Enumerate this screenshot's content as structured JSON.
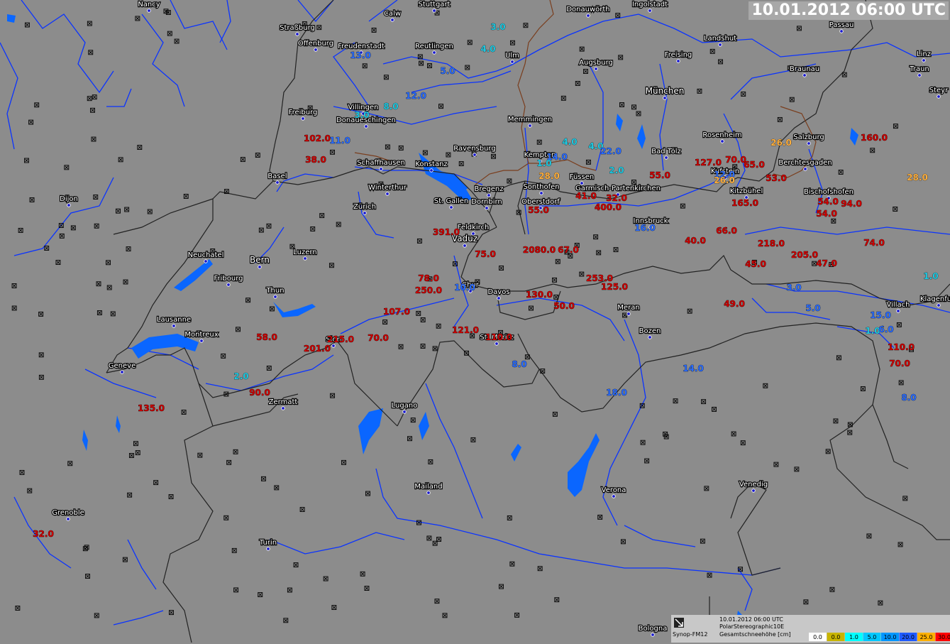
{
  "header": {
    "timestamp": "10.01.2012 06:00 UTC"
  },
  "colors": {
    "background": "#8c8c8c",
    "water": "#0a66ff",
    "border": "#222222",
    "red_value": "#cc0000",
    "cyan_value": "#20c8e0",
    "blue_value": "#2a6cff",
    "orange_value": "#ffb040"
  },
  "cities": [
    {
      "name": "Nancy"
    },
    {
      "name": "Stuttgart"
    },
    {
      "name": "Calw"
    },
    {
      "name": "Donauwörth"
    },
    {
      "name": "Ingolstadt"
    },
    {
      "name": "Straßburg"
    },
    {
      "name": "Offenburg"
    },
    {
      "name": "Freudenstadt"
    },
    {
      "name": "Reutlingen"
    },
    {
      "name": "Ulm"
    },
    {
      "name": "Augsburg"
    },
    {
      "name": "Freising"
    },
    {
      "name": "Landshut"
    },
    {
      "name": "Passau"
    },
    {
      "name": "Linz"
    },
    {
      "name": "Traun"
    },
    {
      "name": "Steyr"
    },
    {
      "name": "Braunau"
    },
    {
      "name": "München"
    },
    {
      "name": "Freiburg"
    },
    {
      "name": "Villingen"
    },
    {
      "name": "Donaueschingen"
    },
    {
      "name": "Memmingen"
    },
    {
      "name": "Ravensburg"
    },
    {
      "name": "Kempten"
    },
    {
      "name": "Bad Tölz"
    },
    {
      "name": "Rosenheim"
    },
    {
      "name": "Salzburg"
    },
    {
      "name": "Schaffhausen"
    },
    {
      "name": "Konstanz"
    },
    {
      "name": "Berchtesgaden"
    },
    {
      "name": "Basel"
    },
    {
      "name": "Kufstein"
    },
    {
      "name": "Füssen"
    },
    {
      "name": "Sonthofen"
    },
    {
      "name": "Garmisch-Partenkirchen"
    },
    {
      "name": "Bregenz"
    },
    {
      "name": "Winterthur"
    },
    {
      "name": "Kitzbühel"
    },
    {
      "name": "Bischofshofen"
    },
    {
      "name": "Dijon"
    },
    {
      "name": "Zürich"
    },
    {
      "name": "St. Gallen"
    },
    {
      "name": "Dornbirn"
    },
    {
      "name": "Oberstdorf"
    },
    {
      "name": "Innsbruck"
    },
    {
      "name": "Feldkirch"
    },
    {
      "name": "Vaduz"
    },
    {
      "name": "Neuchatel"
    },
    {
      "name": "Luzern"
    },
    {
      "name": "Bern"
    },
    {
      "name": "Fribourg"
    },
    {
      "name": "Thun"
    },
    {
      "name": "Chur"
    },
    {
      "name": "Davos"
    },
    {
      "name": "Meran"
    },
    {
      "name": "Villach"
    },
    {
      "name": "Klagenfurt"
    },
    {
      "name": "Lausanne"
    },
    {
      "name": "Montreux"
    },
    {
      "name": "Sion"
    },
    {
      "name": "St. Moritz"
    },
    {
      "name": "Bozen"
    },
    {
      "name": "Geneve"
    },
    {
      "name": "Zermatt"
    },
    {
      "name": "Lugano"
    },
    {
      "name": "Mailand"
    },
    {
      "name": "Verona"
    },
    {
      "name": "Venedig"
    },
    {
      "name": "Grenoble"
    },
    {
      "name": "Turin"
    },
    {
      "name": "Bologna"
    }
  ],
  "values": [
    {
      "text": "3.0",
      "cat": "c"
    },
    {
      "text": "4.0",
      "cat": "c"
    },
    {
      "text": "13.0",
      "cat": "b"
    },
    {
      "text": "5.0",
      "cat": "b"
    },
    {
      "text": "12.0",
      "cat": "b"
    },
    {
      "text": "8.0",
      "cat": "c"
    },
    {
      "text": "3.0",
      "cat": "c"
    },
    {
      "text": "11.0",
      "cat": "b"
    },
    {
      "text": "102.0",
      "cat": "r"
    },
    {
      "text": "38.0",
      "cat": "r"
    },
    {
      "text": "4.0",
      "cat": "c"
    },
    {
      "text": "4.0",
      "cat": "c"
    },
    {
      "text": "22.0",
      "cat": "b"
    },
    {
      "text": "14.0",
      "cat": "b"
    },
    {
      "text": "2.0",
      "cat": "c"
    },
    {
      "text": "28.0",
      "cat": "o"
    },
    {
      "text": "1.0",
      "cat": "c"
    },
    {
      "text": "55.0",
      "cat": "r"
    },
    {
      "text": "127.0",
      "cat": "r"
    },
    {
      "text": "70.0",
      "cat": "r"
    },
    {
      "text": "65.0",
      "cat": "r"
    },
    {
      "text": "12.0",
      "cat": "b"
    },
    {
      "text": "26.0",
      "cat": "o"
    },
    {
      "text": "53.0",
      "cat": "r"
    },
    {
      "text": "26.0",
      "cat": "o"
    },
    {
      "text": "160.0",
      "cat": "r"
    },
    {
      "text": "28.0",
      "cat": "o"
    },
    {
      "text": "41.0",
      "cat": "r"
    },
    {
      "text": "32.0",
      "cat": "r"
    },
    {
      "text": "400.0",
      "cat": "r"
    },
    {
      "text": "55.0",
      "cat": "r"
    },
    {
      "text": "165.0",
      "cat": "r"
    },
    {
      "text": "54.0",
      "cat": "r"
    },
    {
      "text": "94.0",
      "cat": "r"
    },
    {
      "text": "54.0",
      "cat": "r"
    },
    {
      "text": "16.0",
      "cat": "b"
    },
    {
      "text": "391.0",
      "cat": "r"
    },
    {
      "text": "75.0",
      "cat": "r"
    },
    {
      "text": "2080.0",
      "cat": "r"
    },
    {
      "text": "67.0",
      "cat": "r"
    },
    {
      "text": "40.0",
      "cat": "r"
    },
    {
      "text": "66.0",
      "cat": "r"
    },
    {
      "text": "218.0",
      "cat": "r"
    },
    {
      "text": "74.0",
      "cat": "r"
    },
    {
      "text": "45.0",
      "cat": "r"
    },
    {
      "text": "205.0",
      "cat": "r"
    },
    {
      "text": "47.0",
      "cat": "r"
    },
    {
      "text": "1.0",
      "cat": "c"
    },
    {
      "text": "78.0",
      "cat": "r"
    },
    {
      "text": "250.0",
      "cat": "r"
    },
    {
      "text": "10.0",
      "cat": "b"
    },
    {
      "text": "253.0",
      "cat": "r"
    },
    {
      "text": "125.0",
      "cat": "r"
    },
    {
      "text": "130.0",
      "cat": "r"
    },
    {
      "text": "3.0",
      "cat": "b"
    },
    {
      "text": "5.0",
      "cat": "b"
    },
    {
      "text": "49.0",
      "cat": "r"
    },
    {
      "text": "15.0",
      "cat": "b"
    },
    {
      "text": "107.0",
      "cat": "r"
    },
    {
      "text": "50.0",
      "cat": "r"
    },
    {
      "text": "1.0",
      "cat": "c"
    },
    {
      "text": "6.0",
      "cat": "b"
    },
    {
      "text": "121.0",
      "cat": "r"
    },
    {
      "text": "110.0",
      "cat": "r"
    },
    {
      "text": "58.0",
      "cat": "r"
    },
    {
      "text": "215.0",
      "cat": "r"
    },
    {
      "text": "70.0",
      "cat": "r"
    },
    {
      "text": "201.0",
      "cat": "r"
    },
    {
      "text": "110.0",
      "cat": "r"
    },
    {
      "text": "70.0",
      "cat": "r"
    },
    {
      "text": "8.0",
      "cat": "b"
    },
    {
      "text": "14.0",
      "cat": "b"
    },
    {
      "text": "2.0",
      "cat": "c"
    },
    {
      "text": "90.0",
      "cat": "r"
    },
    {
      "text": "18.0",
      "cat": "b"
    },
    {
      "text": "8.0",
      "cat": "b"
    },
    {
      "text": "135.0",
      "cat": "r"
    },
    {
      "text": "32.0",
      "cat": "r"
    }
  ],
  "legend": {
    "timestamp": "10.01.2012 06:00 UTC",
    "projection": "PolarStereographic10E",
    "source": "Synop-FM12",
    "title": "Gesamtschneehöhe [cm]",
    "unit": "[cm]",
    "items": [
      {
        "label": "0.0",
        "color": "#ffffff"
      },
      {
        "label": "0.0",
        "color": "#c8b400"
      },
      {
        "label": "1.0",
        "color": "#00ffff"
      },
      {
        "label": "5.0",
        "color": "#00c8ff"
      },
      {
        "label": "10.0",
        "color": "#0096ff"
      },
      {
        "label": "20.0",
        "color": "#1f5aff"
      },
      {
        "label": "25.0",
        "color": "#ffb000"
      },
      {
        "label": "30.0",
        "color": "#ff0000"
      }
    ]
  }
}
